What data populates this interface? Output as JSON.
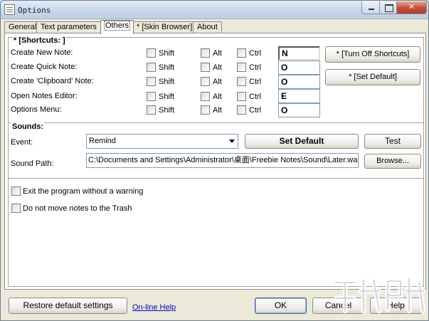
{
  "window": {
    "title": "Options"
  },
  "tabs": [
    {
      "label": "General"
    },
    {
      "label": "Text parameters"
    },
    {
      "label": "Others"
    },
    {
      "label": "* [Skin Browser]"
    },
    {
      "label": "About"
    }
  ],
  "shortcuts": {
    "legend": "* [Shortcuts: ]",
    "modifier_labels": {
      "shift": "Shift",
      "alt": "Alt",
      "ctrl": "Ctrl"
    },
    "rows": [
      {
        "label": "Create New Note:",
        "key": "N"
      },
      {
        "label": "Create Quick Note:",
        "key": "O"
      },
      {
        "label": "Create 'Clipboard' Note:",
        "key": "O"
      },
      {
        "label": "Open Notes Editor:",
        "key": "E"
      },
      {
        "label": "Options Menu:",
        "key": "O"
      }
    ],
    "turn_off_label": "* [Turn Off Shortcuts]",
    "set_default_label": "* [Set Default]"
  },
  "sounds": {
    "legend": "Sounds:",
    "event_label": "Event:",
    "event_value": "Remind",
    "set_default_label": "Set Default",
    "test_label": "Test",
    "path_label": "Sound Path:",
    "path_value": "C:\\Documents and Settings\\Administrator\\桌面\\Freebie Notes\\Sound\\Later.wa",
    "browse_label": "Browse..."
  },
  "options": {
    "exit_warning_label": "Exit the program without a warning",
    "no_trash_label": "Do not move notes to the Trash"
  },
  "footer": {
    "restore_label": "Restore default settings",
    "help_link": "On-line Help",
    "ok_label": "OK",
    "cancel_label": "Cancel",
    "help_label": "Help"
  }
}
